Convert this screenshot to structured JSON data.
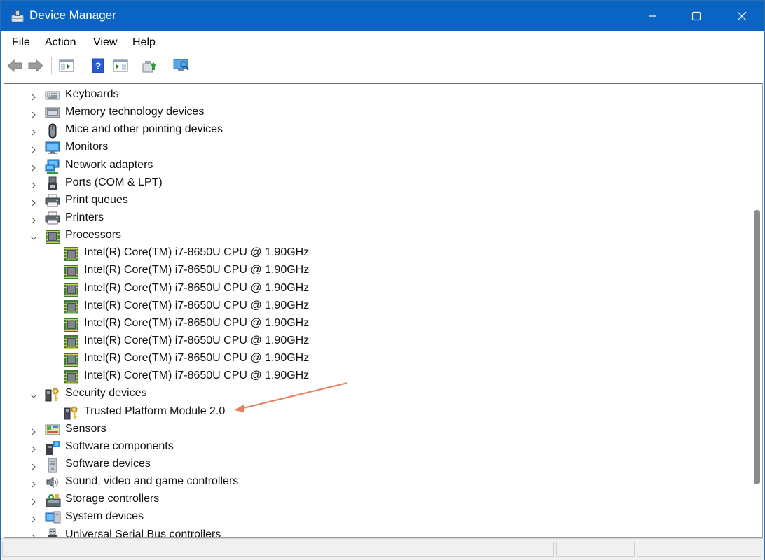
{
  "window": {
    "title": "Device Manager",
    "minimize": "minimize",
    "maximize": "maximize",
    "close": "close"
  },
  "menu": [
    "File",
    "Action",
    "View",
    "Help"
  ],
  "toolbar": [
    "back",
    "forward",
    "show-hide-console-tree",
    "help",
    "properties",
    "update-driver",
    "scan-hardware"
  ],
  "tree": [
    {
      "label": "Keyboards",
      "level": 0,
      "state": "collapsed",
      "icon": "keyboard-icon"
    },
    {
      "label": "Memory technology devices",
      "level": 0,
      "state": "collapsed",
      "icon": "memory-icon"
    },
    {
      "label": "Mice and other pointing devices",
      "level": 0,
      "state": "collapsed",
      "icon": "mouse-icon"
    },
    {
      "label": "Monitors",
      "level": 0,
      "state": "collapsed",
      "icon": "monitor-icon"
    },
    {
      "label": "Network adapters",
      "level": 0,
      "state": "collapsed",
      "icon": "network-icon"
    },
    {
      "label": "Ports (COM & LPT)",
      "level": 0,
      "state": "collapsed",
      "icon": "port-icon"
    },
    {
      "label": "Print queues",
      "level": 0,
      "state": "collapsed",
      "icon": "printer-icon"
    },
    {
      "label": "Printers",
      "level": 0,
      "state": "collapsed",
      "icon": "printer-icon"
    },
    {
      "label": "Processors",
      "level": 0,
      "state": "expanded",
      "icon": "processor-icon"
    },
    {
      "label": "Intel(R) Core(TM) i7-8650U CPU @ 1.90GHz",
      "level": 1,
      "state": "leaf",
      "icon": "processor-icon"
    },
    {
      "label": "Intel(R) Core(TM) i7-8650U CPU @ 1.90GHz",
      "level": 1,
      "state": "leaf",
      "icon": "processor-icon"
    },
    {
      "label": "Intel(R) Core(TM) i7-8650U CPU @ 1.90GHz",
      "level": 1,
      "state": "leaf",
      "icon": "processor-icon"
    },
    {
      "label": "Intel(R) Core(TM) i7-8650U CPU @ 1.90GHz",
      "level": 1,
      "state": "leaf",
      "icon": "processor-icon"
    },
    {
      "label": "Intel(R) Core(TM) i7-8650U CPU @ 1.90GHz",
      "level": 1,
      "state": "leaf",
      "icon": "processor-icon"
    },
    {
      "label": "Intel(R) Core(TM) i7-8650U CPU @ 1.90GHz",
      "level": 1,
      "state": "leaf",
      "icon": "processor-icon"
    },
    {
      "label": "Intel(R) Core(TM) i7-8650U CPU @ 1.90GHz",
      "level": 1,
      "state": "leaf",
      "icon": "processor-icon"
    },
    {
      "label": "Intel(R) Core(TM) i7-8650U CPU @ 1.90GHz",
      "level": 1,
      "state": "leaf",
      "icon": "processor-icon"
    },
    {
      "label": "Security devices",
      "level": 0,
      "state": "expanded",
      "icon": "security-key-icon"
    },
    {
      "label": "Trusted Platform Module 2.0",
      "level": 1,
      "state": "leaf",
      "icon": "security-key-icon"
    },
    {
      "label": "Sensors",
      "level": 0,
      "state": "collapsed",
      "icon": "sensor-icon"
    },
    {
      "label": "Software components",
      "level": 0,
      "state": "collapsed",
      "icon": "software-component-icon"
    },
    {
      "label": "Software devices",
      "level": 0,
      "state": "collapsed",
      "icon": "software-device-icon"
    },
    {
      "label": "Sound, video and game controllers",
      "level": 0,
      "state": "collapsed",
      "icon": "speaker-icon"
    },
    {
      "label": "Storage controllers",
      "level": 0,
      "state": "collapsed",
      "icon": "storage-icon"
    },
    {
      "label": "System devices",
      "level": 0,
      "state": "collapsed",
      "icon": "system-device-icon"
    },
    {
      "label": "Universal Serial Bus controllers",
      "level": 0,
      "state": "collapsed",
      "icon": "usb-icon"
    }
  ],
  "colors": {
    "titlebar": "#0a64c4",
    "annotation_arrow": "#e8805f"
  }
}
